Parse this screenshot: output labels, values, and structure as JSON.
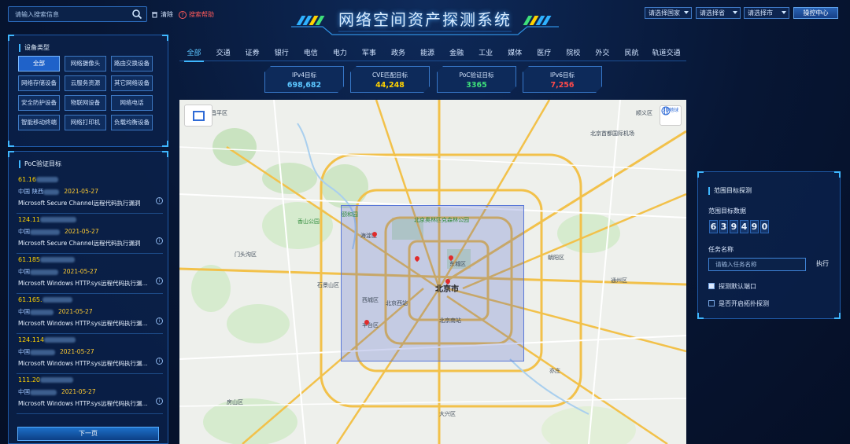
{
  "header": {
    "search_placeholder": "请输入搜索信息",
    "clear_label": "清除",
    "help_label": "搜索帮助",
    "title": "网络空间资产探测系统",
    "select_country": "请选择国家",
    "select_province": "请选择省",
    "select_city": "请选择市",
    "ops_center": "操控中心"
  },
  "device_types": {
    "title": "设备类型",
    "items": [
      "全部",
      "网络摄像头",
      "路由交换设备",
      "网络存储设备",
      "云服务资源",
      "其它网络设备",
      "安全防护设备",
      "物联网设备",
      "网络电话",
      "智能移动终端",
      "网络打印机",
      "负载均衡设备"
    ]
  },
  "poc": {
    "title": "PoC验证目标",
    "items": [
      {
        "ip": "61.16",
        "country": "中国 陕西",
        "date": "2021-05-27",
        "desc": "Microsoft Secure Channel远程代码执行漏洞"
      },
      {
        "ip": "124.11",
        "country": "中国",
        "date": "2021-05-27",
        "desc": "Microsoft Secure Channel远程代码执行漏洞"
      },
      {
        "ip": "61.185",
        "country": "中国",
        "date": "2021-05-27",
        "desc": "Microsoft Windows HTTP.sys远程代码执行漏..."
      },
      {
        "ip": "61.165.",
        "country": "中国",
        "date": "2021-05-27",
        "desc": "Microsoft Windows HTTP.sys远程代码执行漏..."
      },
      {
        "ip": "124.114",
        "country": "中国",
        "date": "2021-05-27",
        "desc": "Microsoft Windows HTTP.sys远程代码执行漏..."
      },
      {
        "ip": "111.20",
        "country": "中国",
        "date": "2021-05-27",
        "desc": "Microsoft Windows HTTP.sys远程代码执行漏..."
      }
    ],
    "next_page": "下一页"
  },
  "categories": [
    "全部",
    "交通",
    "证券",
    "银行",
    "电信",
    "电力",
    "军事",
    "政务",
    "能源",
    "金融",
    "工业",
    "媒体",
    "医疗",
    "院校",
    "外交",
    "民航",
    "轨道交通"
  ],
  "stats": [
    {
      "label": "IPv4目标",
      "value": "698,682",
      "color": "#5cc6ff"
    },
    {
      "label": "CVE匹配目标",
      "value": "44,248",
      "color": "#ffd200"
    },
    {
      "label": "PoC验证目标",
      "value": "3365",
      "color": "#3ee07a"
    },
    {
      "label": "IPv6目标",
      "value": "7,256",
      "color": "#ff4a4a"
    }
  ],
  "map": {
    "three_d": "3D地球",
    "labels": {
      "beijing": "北京市",
      "shijingshan": "石景山区",
      "xicheng": "西城区",
      "dongcheng": "东城区",
      "haidian": "海淀区",
      "fengtai": "丰台区",
      "chaoyang": "朝阳区",
      "tongzhou": "通州区",
      "mentougou": "门头沟区",
      "beijing_west": "北京西站",
      "beijing_south": "北京南站",
      "capital_airport": "北京首都国际机场",
      "shunyi": "顺义区",
      "changping": "昌平区",
      "yizhuang": "亦庄",
      "daxing": "大兴区",
      "fangshan": "房山区",
      "xiangshan": "香山公园",
      "yiheyuan": "颐和园",
      "olympic": "北京奥林匹克森林公园"
    }
  },
  "range_panel": {
    "title": "范围目标探测",
    "count_label": "范围目标数据",
    "digits": [
      "6",
      "3",
      "9",
      "4",
      "9",
      "0"
    ],
    "task_label": "任务名称",
    "task_placeholder": "请输入任务名称",
    "execute": "执行",
    "opt_default_port": "探测默认端口",
    "opt_topology": "是否开启拓扑探测"
  }
}
